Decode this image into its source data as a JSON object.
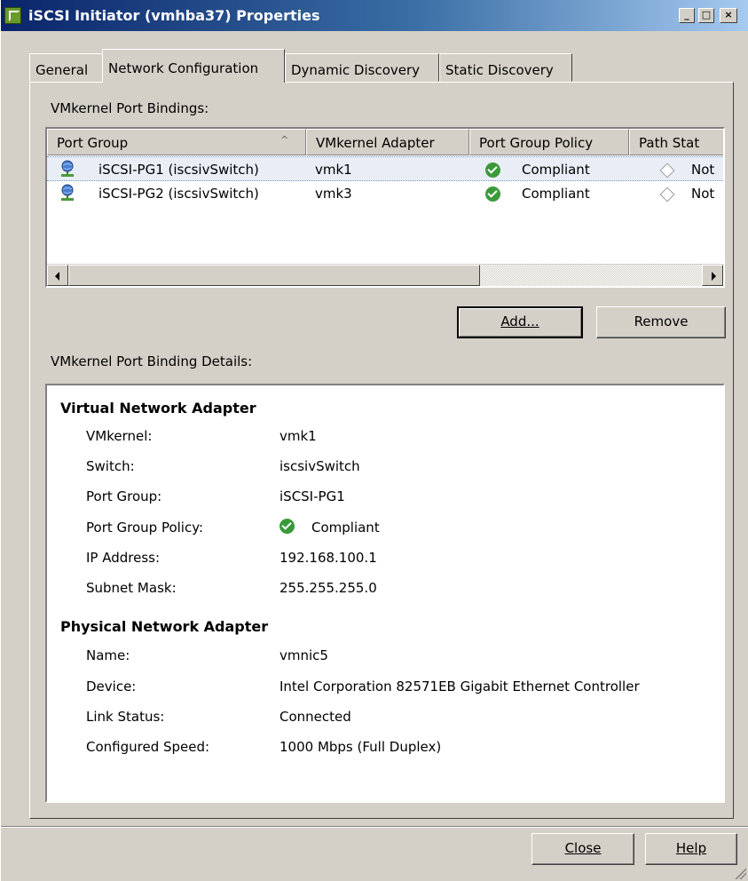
{
  "window": {
    "title": "iSCSI Initiator (vmhba37) Properties",
    "controls": {
      "minimize": "_",
      "maximize": "□",
      "close": "×"
    }
  },
  "tabs": [
    {
      "label": "General"
    },
    {
      "label": "Network Configuration"
    },
    {
      "label": "Dynamic Discovery"
    },
    {
      "label": "Static Discovery"
    }
  ],
  "bindings": {
    "section_label": "VMkernel Port Bindings:",
    "columns": [
      "Port Group",
      "VMkernel Adapter",
      "Port Group Policy",
      "Path Stat"
    ],
    "sort_indicator": "^",
    "rows": [
      {
        "port_group": "iSCSI-PG1 (iscsivSwitch)",
        "adapter": "vmk1",
        "policy": "Compliant",
        "path_status": "Not"
      },
      {
        "port_group": "iSCSI-PG2 (iscsivSwitch)",
        "adapter": "vmk3",
        "policy": "Compliant",
        "path_status": "Not"
      }
    ],
    "selected_row": 0,
    "add_label": "Add...",
    "remove_label": "Remove"
  },
  "details": {
    "section_label": "VMkernel Port Binding Details:",
    "virtual": {
      "heading": "Virtual Network Adapter",
      "fields": [
        {
          "label": "VMkernel:",
          "value": "vmk1"
        },
        {
          "label": "Switch:",
          "value": "iscsivSwitch"
        },
        {
          "label": "Port Group:",
          "value": "iSCSI-PG1"
        },
        {
          "label": "Port Group Policy:",
          "value": "Compliant"
        },
        {
          "label": "IP Address:",
          "value": "192.168.100.1"
        },
        {
          "label": "Subnet Mask:",
          "value": "255.255.255.0"
        }
      ]
    },
    "physical": {
      "heading": "Physical Network Adapter",
      "fields": [
        {
          "label": "Name:",
          "value": "vmnic5"
        },
        {
          "label": "Device:",
          "value": "Intel Corporation 82571EB Gigabit Ethernet Controller"
        },
        {
          "label": "Link Status:",
          "value": "Connected"
        },
        {
          "label": "Configured Speed:",
          "value": "1000 Mbps (Full Duplex)"
        }
      ]
    }
  },
  "footer": {
    "close_label": "Close",
    "help_label": "Help"
  },
  "colors": {
    "title_start": "#0a246a",
    "compliant_green": "#3a9a3a",
    "selection": "#e9eef6"
  }
}
